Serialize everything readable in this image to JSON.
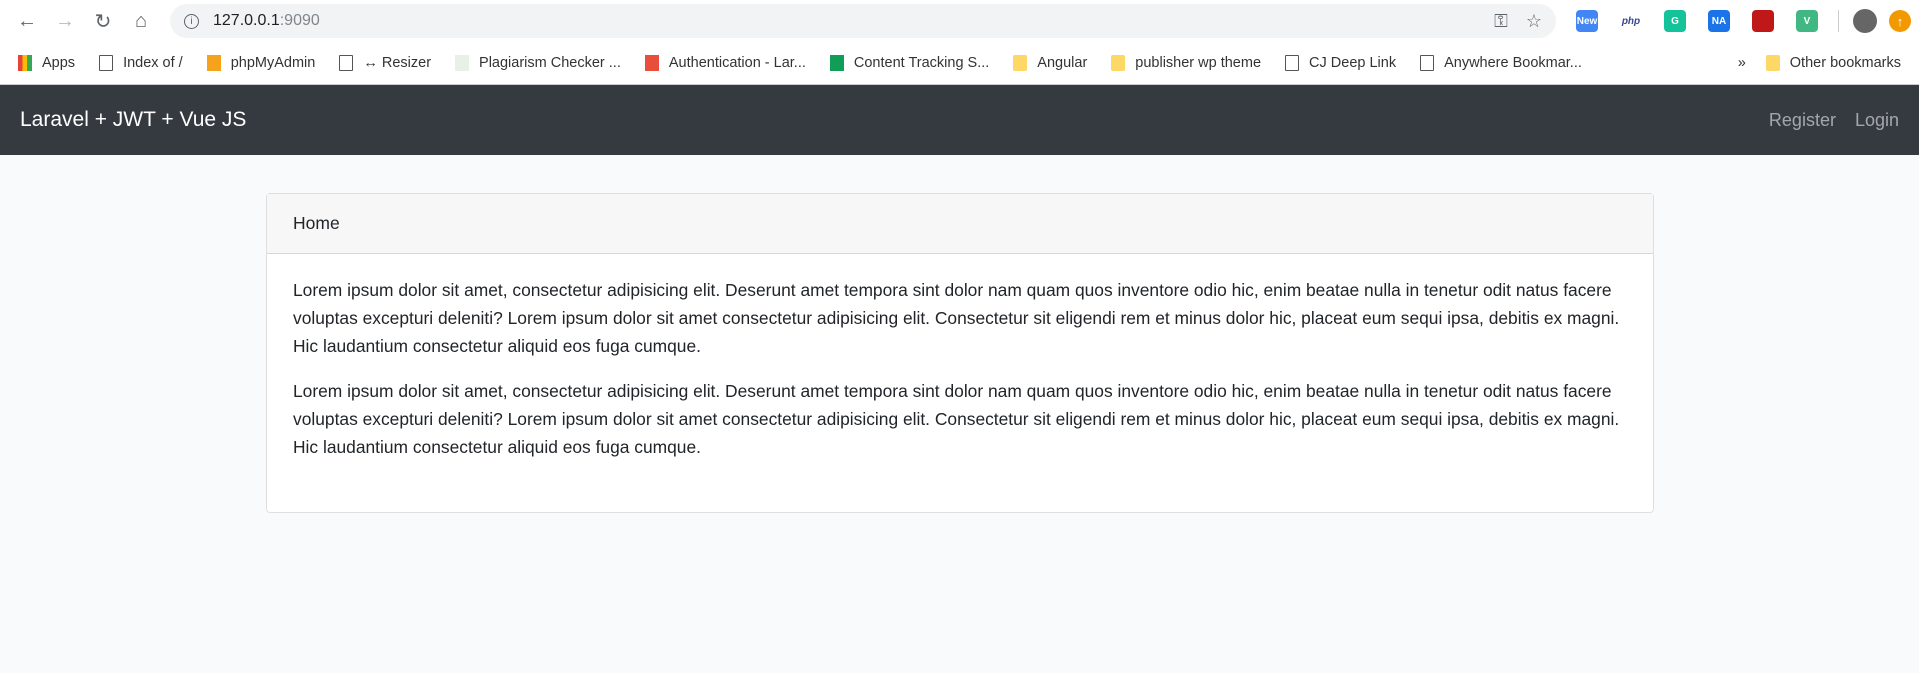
{
  "browser": {
    "url_host": "127.0.0.1",
    "url_port": ":9090",
    "extensions": [
      {
        "name": "new-extension",
        "label": "New",
        "color": "#4285f4"
      },
      {
        "name": "php-extension",
        "label": "php",
        "color": "#ffffff"
      },
      {
        "name": "grammarly-extension",
        "label": "G",
        "color": "#15c39a"
      },
      {
        "name": "na-extension",
        "label": "NA",
        "color": "#1a73e8"
      },
      {
        "name": "mcafee-extension",
        "label": "",
        "color": "#c01818"
      },
      {
        "name": "vue-devtools-extension",
        "label": "V",
        "color": "#41b883"
      }
    ],
    "bookmarks": [
      {
        "label": "Apps",
        "icon": "apps-grid-icon"
      },
      {
        "label": "Index of /",
        "icon": "page-icon"
      },
      {
        "label": "phpMyAdmin",
        "icon": "phpmyadmin-icon"
      },
      {
        "label": "↔ Resizer",
        "icon": "page-icon"
      },
      {
        "label": "Plagiarism Checker ...",
        "icon": "sst-icon"
      },
      {
        "label": "Authentication - Lar...",
        "icon": "s-icon"
      },
      {
        "label": "Content Tracking S...",
        "icon": "sheets-icon"
      },
      {
        "label": "Angular",
        "icon": "folder-icon"
      },
      {
        "label": "publisher wp theme",
        "icon": "folder-icon"
      },
      {
        "label": "CJ Deep Link",
        "icon": "page-icon"
      },
      {
        "label": "Anywhere Bookmar...",
        "icon": "page-icon"
      }
    ],
    "more_label": "»",
    "other_bookmarks": "Other bookmarks"
  },
  "navbar": {
    "brand": "Laravel + JWT + Vue JS",
    "links": [
      "Register",
      "Login"
    ]
  },
  "card": {
    "header": "Home",
    "paragraphs": [
      "Lorem ipsum dolor sit amet, consectetur adipisicing elit. Deserunt amet tempora sint dolor nam quam quos inventore odio hic, enim beatae nulla in tenetur odit natus facere voluptas excepturi deleniti? Lorem ipsum dolor sit amet consectetur adipisicing elit. Consectetur sit eligendi rem et minus dolor hic, placeat eum sequi ipsa, debitis ex magni. Hic laudantium consectetur aliquid eos fuga cumque.",
      "Lorem ipsum dolor sit amet, consectetur adipisicing elit. Deserunt amet tempora sint dolor nam quam quos inventore odio hic, enim beatae nulla in tenetur odit natus facere voluptas excepturi deleniti? Lorem ipsum dolor sit amet consectetur adipisicing elit. Consectetur sit eligendi rem et minus dolor hic, placeat eum sequi ipsa, debitis ex magni. Hic laudantium consectetur aliquid eos fuga cumque."
    ]
  }
}
